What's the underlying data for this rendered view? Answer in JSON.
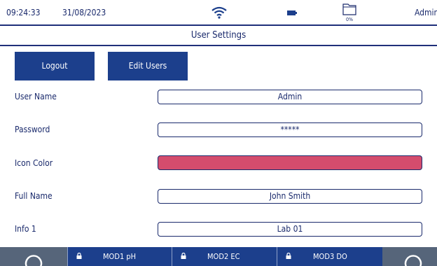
{
  "status": {
    "time": "09:24:33",
    "date": "31/08/2023",
    "storage_percent": "0%",
    "user": "Admin"
  },
  "page": {
    "title": "User Settings"
  },
  "actions": {
    "logout_label": "Logout",
    "edit_users_label": "Edit Users"
  },
  "fields": {
    "user_name": {
      "label": "User Name",
      "value": "Admin"
    },
    "password": {
      "label": "Password",
      "value": "*****"
    },
    "icon_color": {
      "label": "Icon Color",
      "color": "#d44c6d"
    },
    "full_name": {
      "label": "Full Name",
      "value": "John Smith"
    },
    "info1": {
      "label": "Info 1",
      "value": "Lab 01"
    }
  },
  "modules": [
    {
      "label": "MOD1 pH"
    },
    {
      "label": "MOD2 EC"
    },
    {
      "label": "MOD3 DO"
    }
  ],
  "colors": {
    "accent": "#1c3f8c",
    "text": "#1a2a6c",
    "nav_gray": "#56657a"
  }
}
